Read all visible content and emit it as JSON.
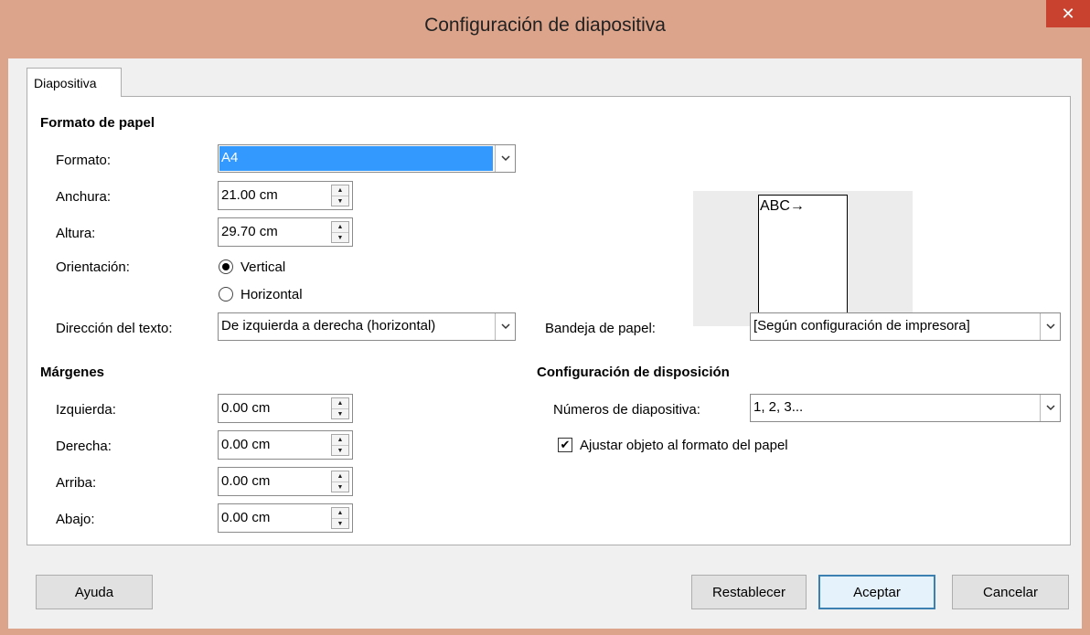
{
  "window": {
    "title": "Configuración de diapositiva",
    "close_glyph": "✕"
  },
  "tab": {
    "label": "Diapositiva"
  },
  "paper": {
    "heading": "Formato de papel",
    "format_label": "Formato:",
    "format_value": "A4",
    "width_label": "Anchura:",
    "width_value": "21.00 cm",
    "height_label": "Altura:",
    "height_value": "29.70 cm",
    "orientation_label": "Orientación:",
    "orientation_options": [
      "Vertical",
      "Horizontal"
    ],
    "orientation_selected": "Vertical",
    "text_direction_label": "Dirección del texto:",
    "text_direction_value": "De izquierda a derecha (horizontal)",
    "tray_label": "Bandeja de papel:",
    "tray_value": "[Según configuración de impresora]",
    "preview_text": "ABC→"
  },
  "margins": {
    "heading": "Márgenes",
    "left_label": "Izquierda:",
    "left_value": "0.00 cm",
    "right_label": "Derecha:",
    "right_value": "0.00 cm",
    "top_label": "Arriba:",
    "top_value": "0.00 cm",
    "bottom_label": "Abajo:",
    "bottom_value": "0.00 cm"
  },
  "layout": {
    "heading": "Configuración de disposición",
    "numbering_label": "Números de diapositiva:",
    "numbering_value": "1, 2, 3...",
    "fit_label": "Ajustar objeto al formato del papel",
    "fit_checked": true
  },
  "buttons": {
    "help": "Ayuda",
    "reset": "Restablecer",
    "ok": "Aceptar",
    "cancel": "Cancelar"
  },
  "icons": {
    "dropdown": "chevron-down-icon",
    "spin_up": "triangle-up-icon",
    "spin_down": "triangle-down-icon",
    "check": "check-icon"
  },
  "colors": {
    "titlebar": "#dca48b",
    "close": "#c9412f",
    "selection": "#3399ff",
    "default_button_border": "#3c7fb1"
  }
}
